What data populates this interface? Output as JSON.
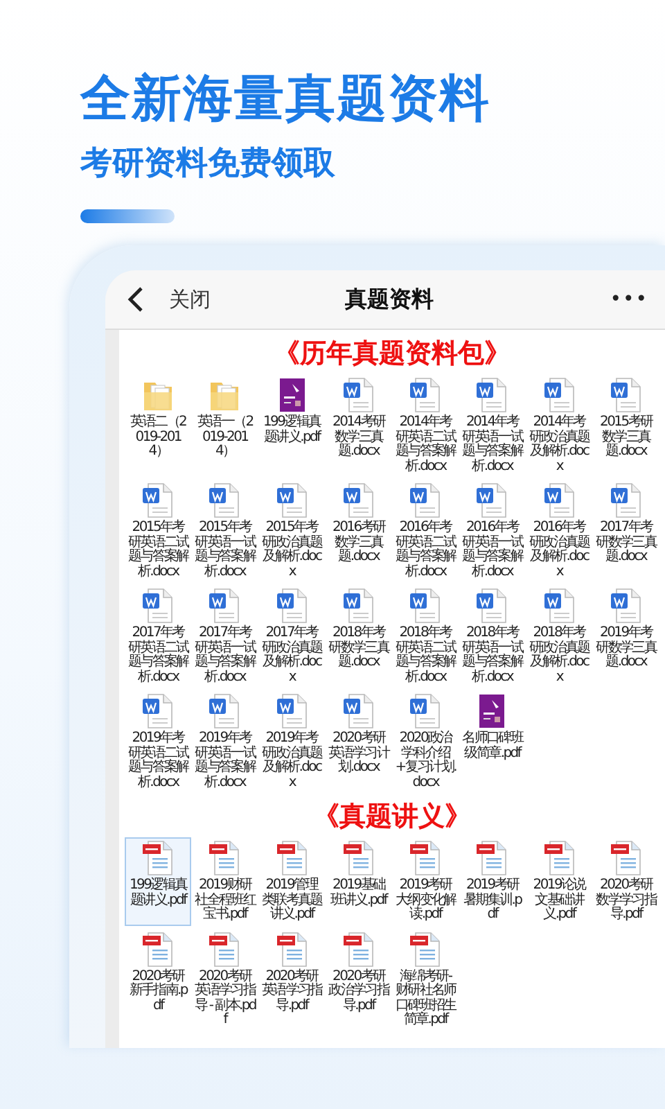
{
  "hero": {
    "title": "全新海量真题资料",
    "subtitle": "考研资料免费领取"
  },
  "nav": {
    "back": "关闭",
    "title": "真题资料",
    "more": "•••"
  },
  "sections": [
    {
      "title": "《历年真题资料包》",
      "files": [
        {
          "name": "英语二（2019-2014）",
          "kind": "folder",
          "selected": false
        },
        {
          "name": "英语一（2019-2014）",
          "kind": "folder",
          "selected": false
        },
        {
          "name": "199逻辑真题讲义.pdf",
          "kind": "cover",
          "selected": false
        },
        {
          "name": "2014考研数学三真题.docx",
          "kind": "word",
          "selected": false
        },
        {
          "name": "2014年考研英语二试题与答案解析.docx",
          "kind": "word",
          "selected": false
        },
        {
          "name": "2014年考研英语一试题与答案解析.docx",
          "kind": "word",
          "selected": false
        },
        {
          "name": "2014年考研政治真题及解析.docx",
          "kind": "word",
          "selected": false
        },
        {
          "name": "2015考研数学三真题.docx",
          "kind": "word",
          "selected": false
        },
        {
          "name": "2015年考研英语二试题与答案解析.docx",
          "kind": "word",
          "selected": false
        },
        {
          "name": "2015年考研英语一试题与答案解析.docx",
          "kind": "word",
          "selected": false
        },
        {
          "name": "2015年考研政治真题及解析.docx",
          "kind": "word",
          "selected": false
        },
        {
          "name": "2016考研数学三真题.docx",
          "kind": "word",
          "selected": false
        },
        {
          "name": "2016年考研英语二试题与答案解析.docx",
          "kind": "word",
          "selected": false
        },
        {
          "name": "2016年考研英语一试题与答案解析.docx",
          "kind": "word",
          "selected": false
        },
        {
          "name": "2016年考研政治真题及解析.docx",
          "kind": "word",
          "selected": false
        },
        {
          "name": "2017年考研数学三真题.docx",
          "kind": "word",
          "selected": false
        },
        {
          "name": "2017年考研英语二试题与答案解析.docx",
          "kind": "word",
          "selected": false
        },
        {
          "name": "2017年考研英语一试题与答案解析.docx",
          "kind": "word",
          "selected": false
        },
        {
          "name": "2017年考研政治真题及解析.docx",
          "kind": "word",
          "selected": false
        },
        {
          "name": "2018年考研数学三真题.docx",
          "kind": "word",
          "selected": false
        },
        {
          "name": "2018年考研英语二试题与答案解析.docx",
          "kind": "word",
          "selected": false
        },
        {
          "name": "2018年考研英语一试题与答案解析.docx",
          "kind": "word",
          "selected": false
        },
        {
          "name": "2018年考研政治真题及解析.docx",
          "kind": "word",
          "selected": false
        },
        {
          "name": "2019年考研数学三真题.docx",
          "kind": "word",
          "selected": false
        },
        {
          "name": "2019年考研英语二试题与答案解析.docx",
          "kind": "word",
          "selected": false
        },
        {
          "name": "2019年考研英语一试题与答案解析.docx",
          "kind": "word",
          "selected": false
        },
        {
          "name": "2019年考研政治真题及解析.docx",
          "kind": "word",
          "selected": false
        },
        {
          "name": "2020考研英语学习计划.docx",
          "kind": "word",
          "selected": false
        },
        {
          "name": "2020政治学科介绍+复习计划.docx",
          "kind": "word",
          "selected": false
        },
        {
          "name": "名师口碑班级简章.pdf",
          "kind": "cover",
          "selected": false
        }
      ]
    },
    {
      "title": "《真题讲义》",
      "files": [
        {
          "name": "199逻辑真题讲义.pdf",
          "kind": "pdf",
          "selected": true
        },
        {
          "name": "2019财研社全程班红宝书.pdf",
          "kind": "pdf",
          "selected": false
        },
        {
          "name": "2019管理类联考真题讲义.pdf",
          "kind": "pdf",
          "selected": false
        },
        {
          "name": "2019基础班讲义.pdf",
          "kind": "pdf",
          "selected": false
        },
        {
          "name": "2019考研大纲变化解读.pdf",
          "kind": "pdf",
          "selected": false
        },
        {
          "name": "2019考研暑期集训.pdf",
          "kind": "pdf",
          "selected": false
        },
        {
          "name": "2019论说文基础讲义.pdf",
          "kind": "pdf",
          "selected": false
        },
        {
          "name": "2020考研数学学习指导.pdf",
          "kind": "pdf",
          "selected": false
        },
        {
          "name": "2020考研新手指南.pdf",
          "kind": "pdf",
          "selected": false
        },
        {
          "name": "2020考研英语学习指导 - 副本.pdf",
          "kind": "pdf",
          "selected": false
        },
        {
          "name": "2020考研英语学习指导.pdf",
          "kind": "pdf",
          "selected": false
        },
        {
          "name": "2020考研政治学习指导.pdf",
          "kind": "pdf",
          "selected": false
        },
        {
          "name": "海绵考研-财研社名师口碑班招生简章.pdf",
          "kind": "pdf",
          "selected": false
        }
      ]
    }
  ]
}
